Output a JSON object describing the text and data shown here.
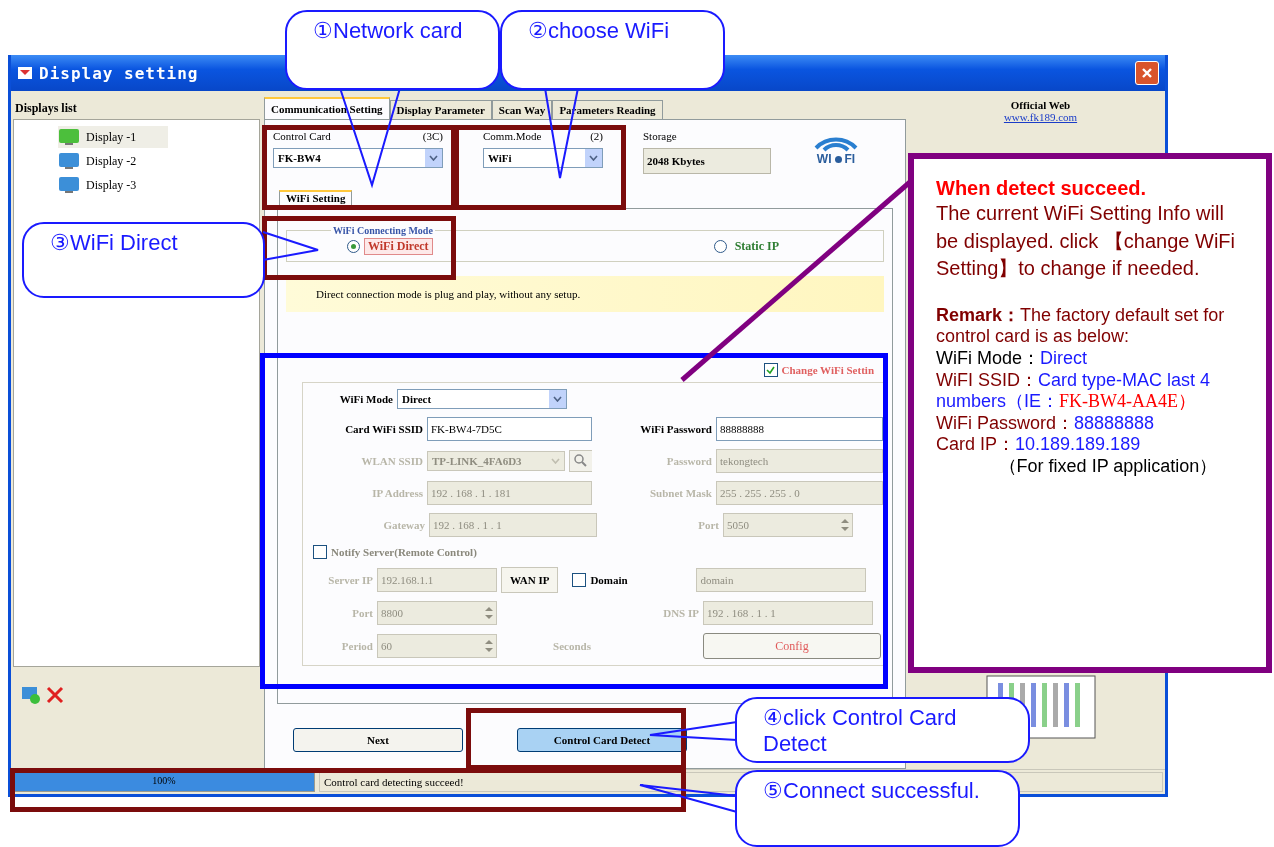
{
  "window": {
    "title": "Display setting"
  },
  "displays_list": {
    "title": "Displays list",
    "items": [
      {
        "label": "Display -1",
        "selected": true
      },
      {
        "label": "Display -2",
        "selected": false
      },
      {
        "label": "Display -3",
        "selected": false
      }
    ]
  },
  "tabs": [
    {
      "label": "Communication Setting",
      "selected": true
    },
    {
      "label": "Display Parameter",
      "selected": false
    },
    {
      "label": "Scan Way",
      "selected": false
    },
    {
      "label": "Parameters Reading",
      "selected": false
    }
  ],
  "control_card": {
    "label": "Control Card",
    "hint": "(3C)",
    "value": "FK-BW4"
  },
  "comm_mode": {
    "label": "Comm.Mode",
    "hint": "(2)",
    "value": "WiFi"
  },
  "storage": {
    "label": "Storage",
    "value": "2048 Kbytes"
  },
  "wifi_logo": [
    "WI",
    "FI"
  ],
  "subtab": {
    "label": "WiFi Setting",
    "selected": true
  },
  "connecting_mode": {
    "title": "WiFi Connecting Mode",
    "options": [
      {
        "label": "WiFi Direct",
        "selected": true
      },
      {
        "label": "Static IP",
        "selected": false
      }
    ]
  },
  "note": "Direct connection mode is plug and play, without any setup.",
  "change_setting": {
    "label": "Change WiFi Settin",
    "checked": true
  },
  "wifi_mode": {
    "label": "WiFi Mode",
    "value": "Direct"
  },
  "ssid": {
    "label": "Card WiFi SSID",
    "value": "FK-BW4-7D5C"
  },
  "password": {
    "label": "WiFi Password",
    "value": "88888888"
  },
  "station_rows": [
    [
      {
        "kind": "dropdown",
        "label": "WLAN SSID",
        "value": "TP-LINK_4FA6D3"
      },
      {
        "kind": "text",
        "label": "Password",
        "value": "tekongtech"
      }
    ],
    [
      {
        "kind": "text",
        "label": "IP Address",
        "value": "192 . 168 . 1 . 181"
      },
      {
        "kind": "text",
        "label": "Subnet Mask",
        "value": "255 . 255 . 255 . 0"
      }
    ],
    [
      {
        "kind": "text",
        "label": "Gateway",
        "value": "192 . 168 . 1 . 1"
      },
      {
        "kind": "spin",
        "label": "Port",
        "value": "5050"
      }
    ]
  ],
  "notify": {
    "label": "Notify Server(Remote Control)",
    "checked": false
  },
  "server": {
    "server_ip": {
      "label": "Server IP",
      "value": "192.168.1.1"
    },
    "wan_button": "WAN IP",
    "domain": {
      "label": "Domain",
      "checked": false,
      "value": "domain"
    },
    "port": {
      "label": "Port",
      "value": "8800"
    },
    "dns": {
      "label": "DNS IP",
      "value": "192 . 168 . 1 . 1"
    },
    "period": {
      "label": "Period",
      "value": "60"
    },
    "unit": "Seconds",
    "config_button": "Config"
  },
  "buttons": [
    {
      "label": "Next",
      "focused": false
    },
    {
      "label": "Control Card Detect",
      "focused": true
    }
  ],
  "status": {
    "level": 1,
    "percent": "100%",
    "message": "Control card detecting succeed!"
  },
  "right_panel": {
    "official_label": "Official Web",
    "link": "www.fk189.com"
  },
  "callouts": [
    {
      "text": "①Network card"
    },
    {
      "text": "②choose WiFi"
    },
    {
      "text": "③WiFi Direct"
    },
    {
      "text": "④click Control Card Detect"
    },
    {
      "text": "⑤Connect successful."
    }
  ],
  "info_box": {
    "heading": "When detect succeed.",
    "description": "The current WiFi Setting Info will be displayed. click 【change WiFi Setting】to change if needed.",
    "remark": "**Remark：**The factory default set for control card is as below:",
    "defaults": [
      {
        "label": "WiFi Mode：",
        "value": "Direct"
      },
      {
        "label": "WiFI SSID：",
        "value": "Card type-MAC last 4 numbers（IE：",
        "example": "FK-BW4-AA4E）"
      },
      {
        "label": "WiFi Password：",
        "value": "88888888"
      },
      {
        "label": "Card IP：",
        "value": "10.189.189.189",
        "note": "（For fixed IP application）"
      }
    ]
  }
}
